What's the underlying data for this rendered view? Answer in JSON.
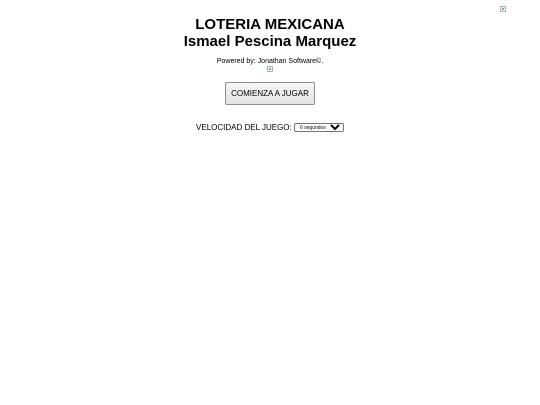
{
  "header": {
    "title_line1": "LOTERIA MEXICANA",
    "title_line2": "Ismael Pescina Marquez",
    "powered_by": "Powered by: Jonathan Software©."
  },
  "controls": {
    "start_label": "COMIENZA A JUGAR",
    "speed_label": "VELOCIDAD DEL JUEGO:",
    "speed_options": [
      "6 segundos"
    ],
    "speed_selected": "6 segundos"
  }
}
